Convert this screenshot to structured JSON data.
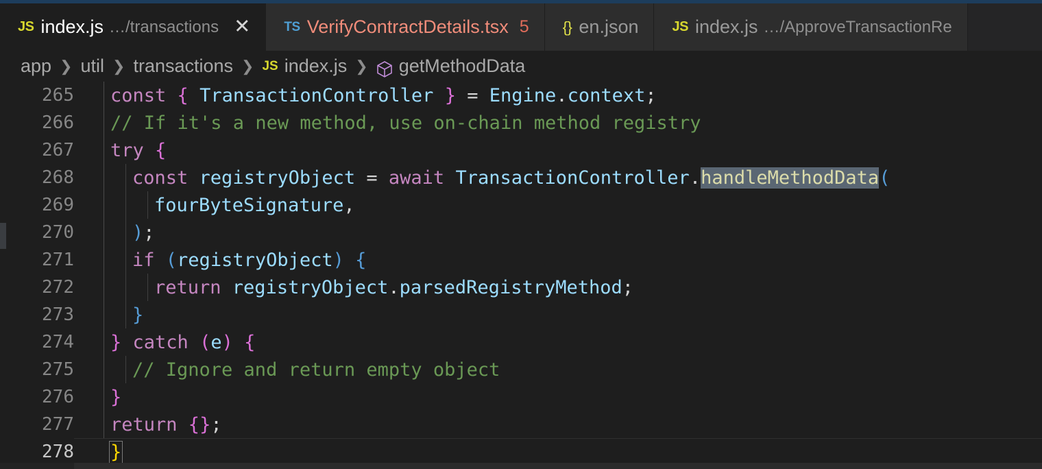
{
  "window": {
    "accent_color": "#1d3d5c",
    "background": "#1e1e1e",
    "tabbar_background": "#252526"
  },
  "tabs": [
    {
      "icon": "js-file-icon",
      "icon_glyph": "JS",
      "label": "index.js",
      "path": "…/transactions",
      "badge": "",
      "close_glyph": "✕",
      "active": true
    },
    {
      "icon": "ts-file-icon",
      "icon_glyph": "TS",
      "label": "VerifyContractDetails.tsx",
      "path": "",
      "badge": "5",
      "close_glyph": "",
      "active": false
    },
    {
      "icon": "json-file-icon",
      "icon_glyph": "{}",
      "label": "en.json",
      "path": "",
      "badge": "",
      "close_glyph": "",
      "active": false
    },
    {
      "icon": "js-file-icon",
      "icon_glyph": "JS",
      "label": "index.js",
      "path": "…/ApproveTransactionRe",
      "badge": "",
      "close_glyph": "",
      "active": false
    }
  ],
  "breadcrumb": {
    "separator": "❯",
    "items": [
      {
        "label": "app",
        "icon": ""
      },
      {
        "label": "util",
        "icon": ""
      },
      {
        "label": "transactions",
        "icon": ""
      },
      {
        "label": "index.js",
        "icon": "js-file-icon"
      },
      {
        "label": "getMethodData",
        "icon": "symbol-method-icon"
      }
    ]
  },
  "editor": {
    "active_line": 278,
    "first_line": 265,
    "colors": {
      "keyword": "#c586c0",
      "variable": "#9cdcfe",
      "function": "#dcdcaa",
      "comment": "#6a9955",
      "punctuation": "#d4d4d4",
      "bracket_magenta": "#da70d6",
      "bracket_blue": "#569cd6",
      "selection": "#5a6673",
      "bracket_match": "#ffd700"
    },
    "lines": [
      {
        "number": "265",
        "indent": 0,
        "active": false,
        "tokens": [
          {
            "t": "const ",
            "c": "kw"
          },
          {
            "t": "{",
            "c": "br1"
          },
          {
            "t": " ",
            "c": "pun"
          },
          {
            "t": "TransactionController",
            "c": "var"
          },
          {
            "t": " ",
            "c": "pun"
          },
          {
            "t": "}",
            "c": "br1"
          },
          {
            "t": " = ",
            "c": "pun"
          },
          {
            "t": "Engine",
            "c": "var"
          },
          {
            "t": ".",
            "c": "pun"
          },
          {
            "t": "context",
            "c": "var"
          },
          {
            "t": ";",
            "c": "pun"
          }
        ]
      },
      {
        "number": "266",
        "indent": 0,
        "active": false,
        "tokens": [
          {
            "t": "// If it's a new method, use on-chain method registry",
            "c": "cmt"
          }
        ]
      },
      {
        "number": "267",
        "indent": 0,
        "active": false,
        "tokens": [
          {
            "t": "try",
            "c": "kw"
          },
          {
            "t": " ",
            "c": "pun"
          },
          {
            "t": "{",
            "c": "br1"
          }
        ]
      },
      {
        "number": "268",
        "indent": 1,
        "active": false,
        "tokens": [
          {
            "t": "const ",
            "c": "kw"
          },
          {
            "t": "registryObject",
            "c": "var"
          },
          {
            "t": " = ",
            "c": "pun"
          },
          {
            "t": "await ",
            "c": "kw"
          },
          {
            "t": "TransactionController",
            "c": "var"
          },
          {
            "t": ".",
            "c": "pun"
          },
          {
            "t": "handleMethodData",
            "c": "fn sel"
          },
          {
            "t": "(",
            "c": "br2"
          }
        ]
      },
      {
        "number": "269",
        "indent": 2,
        "active": false,
        "tokens": [
          {
            "t": "fourByteSignature",
            "c": "var"
          },
          {
            "t": ",",
            "c": "pun"
          }
        ]
      },
      {
        "number": "270",
        "indent": 1,
        "active": false,
        "tokens": [
          {
            "t": ")",
            "c": "br2"
          },
          {
            "t": ";",
            "c": "pun"
          }
        ]
      },
      {
        "number": "271",
        "indent": 1,
        "active": false,
        "tokens": [
          {
            "t": "if ",
            "c": "kw"
          },
          {
            "t": "(",
            "c": "br2"
          },
          {
            "t": "registryObject",
            "c": "var"
          },
          {
            "t": ")",
            "c": "br2"
          },
          {
            "t": " ",
            "c": "pun"
          },
          {
            "t": "{",
            "c": "br2"
          }
        ]
      },
      {
        "number": "272",
        "indent": 2,
        "active": false,
        "tokens": [
          {
            "t": "return ",
            "c": "kw"
          },
          {
            "t": "registryObject",
            "c": "var"
          },
          {
            "t": ".",
            "c": "pun"
          },
          {
            "t": "parsedRegistryMethod",
            "c": "var"
          },
          {
            "t": ";",
            "c": "pun"
          }
        ]
      },
      {
        "number": "273",
        "indent": 1,
        "active": false,
        "tokens": [
          {
            "t": "}",
            "c": "br2"
          }
        ]
      },
      {
        "number": "274",
        "indent": 0,
        "active": false,
        "tokens": [
          {
            "t": "}",
            "c": "br1"
          },
          {
            "t": " ",
            "c": "pun"
          },
          {
            "t": "catch ",
            "c": "kw"
          },
          {
            "t": "(",
            "c": "br1"
          },
          {
            "t": "e",
            "c": "var"
          },
          {
            "t": ")",
            "c": "br1"
          },
          {
            "t": " ",
            "c": "pun"
          },
          {
            "t": "{",
            "c": "br1"
          }
        ]
      },
      {
        "number": "275",
        "indent": 1,
        "active": false,
        "tokens": [
          {
            "t": "// Ignore and return empty object",
            "c": "cmt"
          }
        ]
      },
      {
        "number": "276",
        "indent": 0,
        "active": false,
        "tokens": [
          {
            "t": "}",
            "c": "br1"
          }
        ]
      },
      {
        "number": "277",
        "indent": 0,
        "active": false,
        "tokens": [
          {
            "t": "return ",
            "c": "kw"
          },
          {
            "t": "{",
            "c": "br1"
          },
          {
            "t": "}",
            "c": "br1"
          },
          {
            "t": ";",
            "c": "pun"
          }
        ]
      },
      {
        "number": "278",
        "indent": -1,
        "active": true,
        "tokens": [
          {
            "t": "}",
            "c": "bracketbox"
          }
        ]
      }
    ]
  }
}
